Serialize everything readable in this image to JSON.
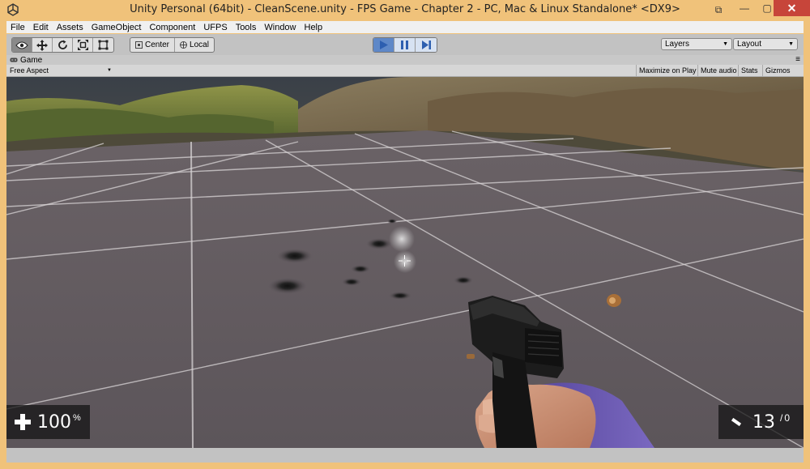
{
  "window": {
    "title": "Unity Personal (64bit) - CleanScene.unity - FPS Game - Chapter 2 - PC, Mac & Linux Standalone* <DX9>",
    "controls": {
      "restore_alt": "⧉",
      "minimize": "—",
      "maximize": "▢",
      "close": "✕"
    },
    "frame_color": "#f0c27a",
    "close_color": "#c7453a"
  },
  "menu": {
    "items": [
      "File",
      "Edit",
      "Assets",
      "GameObject",
      "Component",
      "UFPS",
      "Tools",
      "Window",
      "Help"
    ]
  },
  "toolbar": {
    "pivot_center": "Center",
    "pivot_local": "Local",
    "layers_label": "Layers",
    "layout_label": "Layout",
    "play_active_color": "#5e88c8"
  },
  "game_view": {
    "tab_label": "Game",
    "aspect": "Free Aspect",
    "maximize_on_play": "Maximize on Play",
    "mute_audio": "Mute audio",
    "stats": "Stats",
    "gizmos": "Gizmos"
  },
  "hud": {
    "health": {
      "value": "100",
      "unit": "%"
    },
    "ammo": {
      "clip": "13",
      "separator": "/",
      "reserve": "0"
    }
  }
}
